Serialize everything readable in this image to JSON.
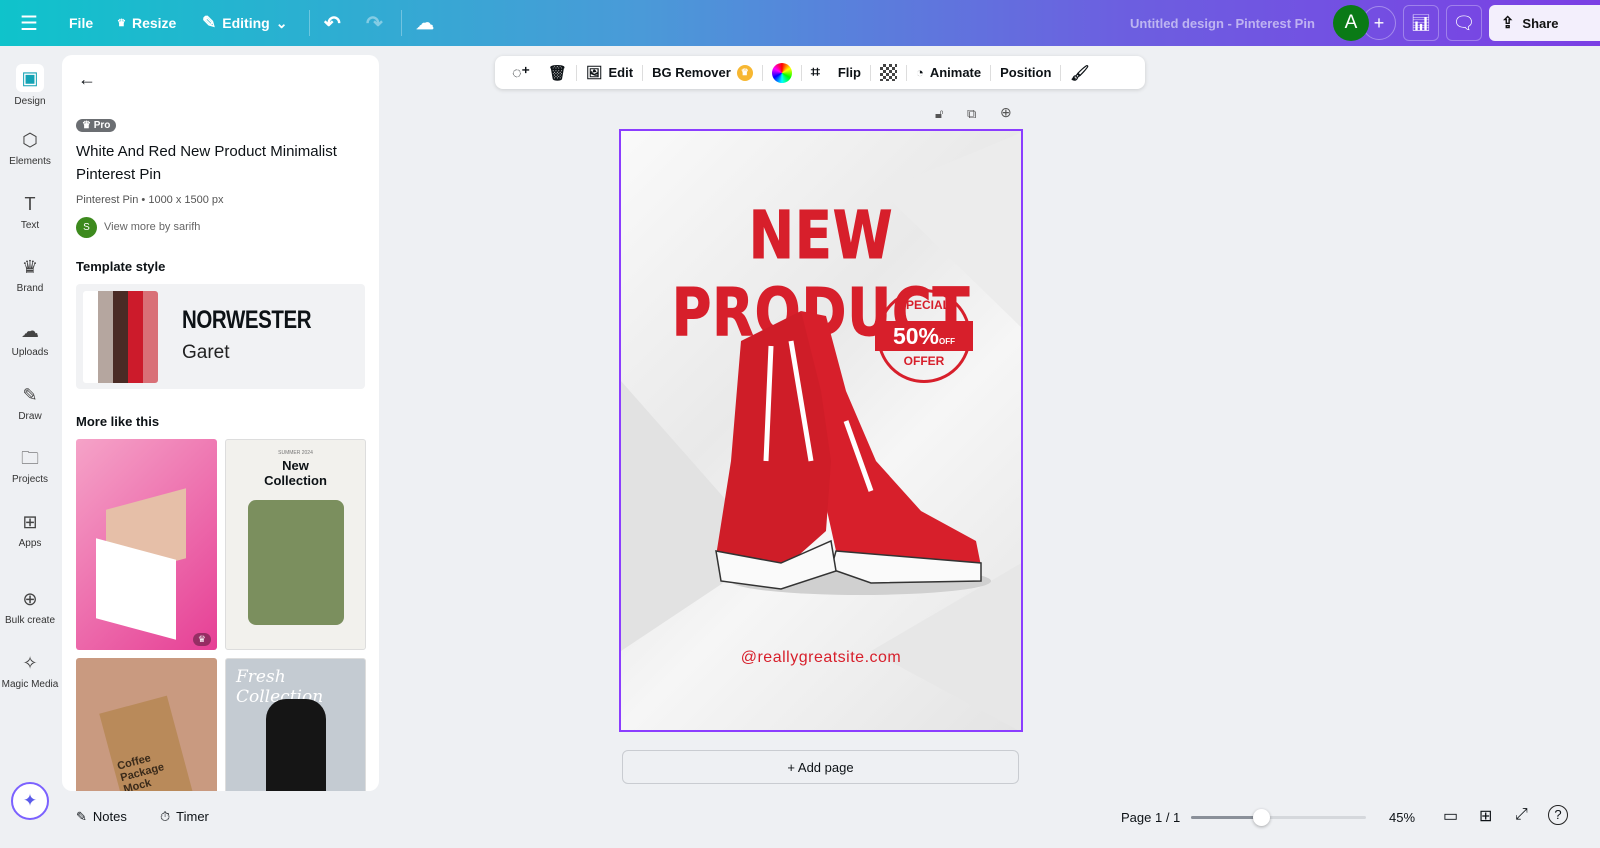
{
  "topbar": {
    "file": "File",
    "resize": "Resize",
    "editing": "Editing",
    "doc_title": "Untitled design - Pinterest Pin",
    "avatar": "A",
    "share": "Share"
  },
  "rail": [
    {
      "label": "Design",
      "icon": "design-icon"
    },
    {
      "label": "Elements",
      "icon": "elements-icon"
    },
    {
      "label": "Text",
      "icon": "text-icon"
    },
    {
      "label": "Brand",
      "icon": "brand-icon"
    },
    {
      "label": "Uploads",
      "icon": "uploads-icon"
    },
    {
      "label": "Draw",
      "icon": "draw-icon"
    },
    {
      "label": "Projects",
      "icon": "projects-icon"
    },
    {
      "label": "Apps",
      "icon": "apps-icon"
    },
    {
      "label": "Bulk create",
      "icon": "bulk-create-icon"
    },
    {
      "label": "Magic Media",
      "icon": "magic-media-icon"
    }
  ],
  "panel": {
    "badge": "Pro",
    "title": "White And Red New Product Minimalist Pinterest Pin",
    "meta": "Pinterest Pin • 1000 x 1500 px",
    "author_initial": "S",
    "author_link": "View more by sarifh",
    "style_heading": "Template style",
    "palette": [
      "#ffffff",
      "#b5a69f",
      "#4a2b25",
      "#cc1b2b",
      "#d97077"
    ],
    "font_heading": "NORWESTER",
    "font_body": "Garet",
    "more_heading": "More like this",
    "thumb2_small": "SUMMER 2024",
    "thumb2_title": "New Collection",
    "thumb3_text": "Coffee Package Mock",
    "thumb4_text": "Fresh Collection"
  },
  "toolbar": {
    "edit": "Edit",
    "bg_remover": "BG Remover",
    "flip": "Flip",
    "animate": "Animate",
    "position": "Position"
  },
  "design": {
    "headline": "NEW PRODUCT",
    "stamp_top": "SPECIAL",
    "stamp_mid": "50%",
    "stamp_off": "OFF",
    "stamp_bottom": "OFFER",
    "website": "@reallygreatsite.com",
    "accent": "#d71f2b"
  },
  "add_page": "+ Add page",
  "bottom": {
    "notes": "Notes",
    "timer": "Timer",
    "page": "Page 1 / 1",
    "zoom": "45%",
    "zoom_fraction": 0.45
  }
}
